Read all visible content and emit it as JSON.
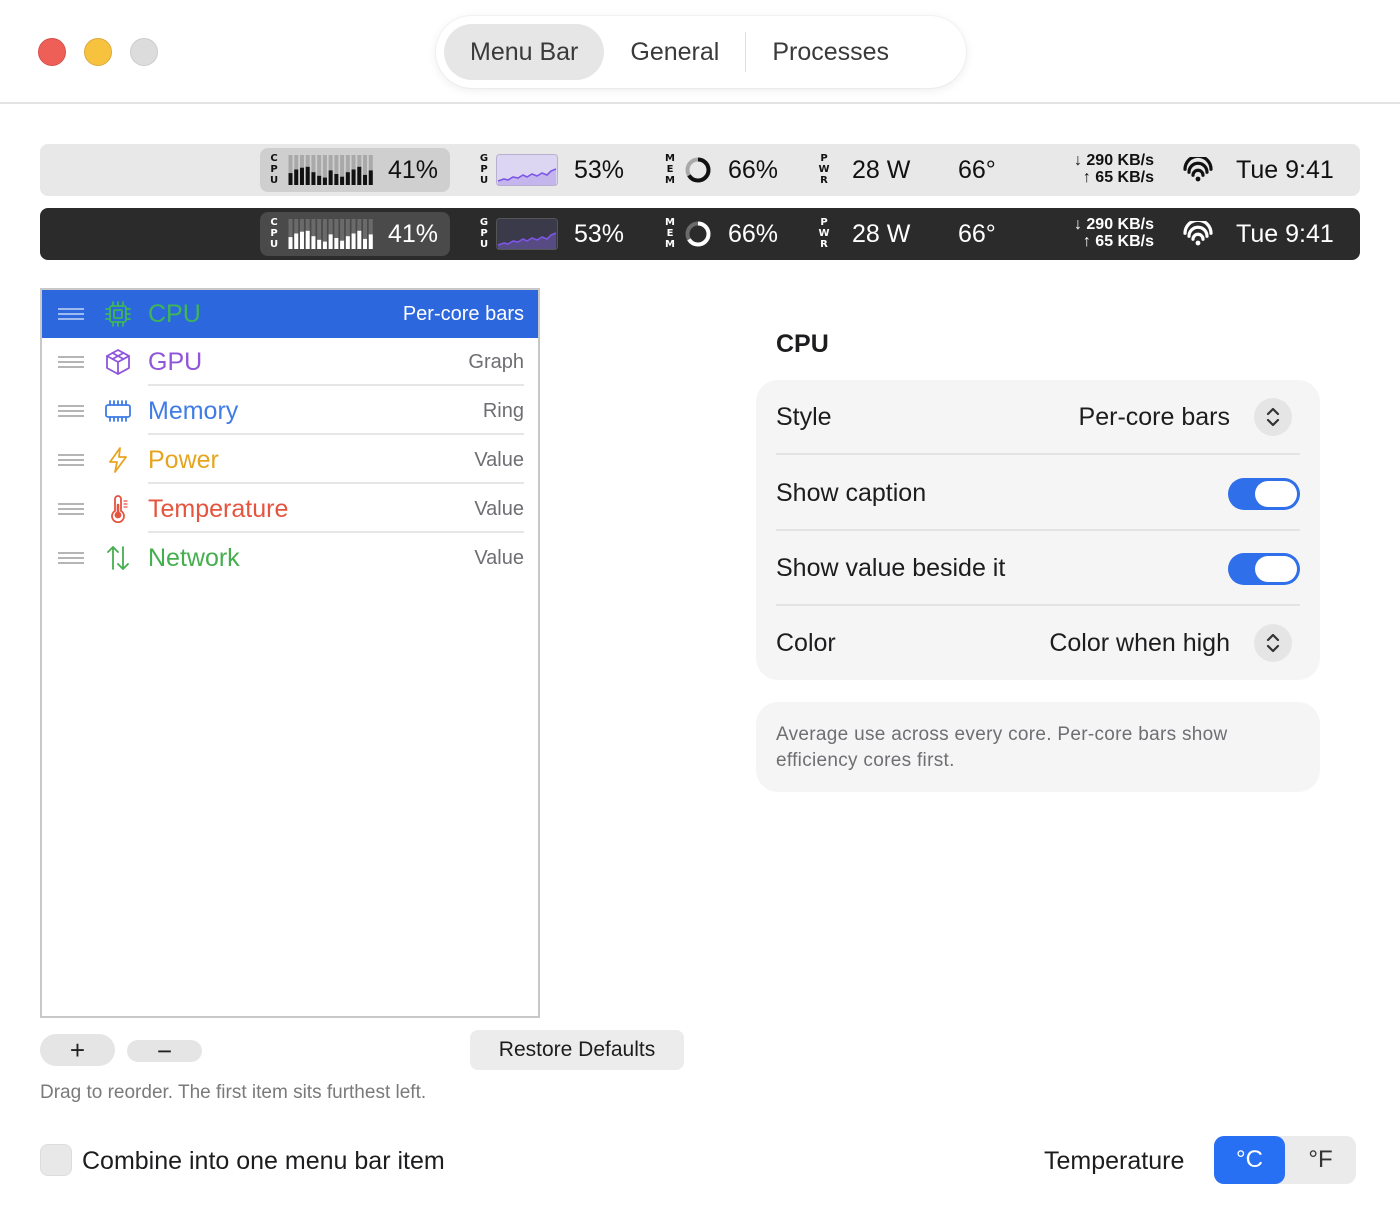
{
  "window": {
    "tabs": [
      {
        "label": "Menu Bar",
        "active": true
      },
      {
        "label": "General",
        "active": false
      },
      {
        "label": "Processes",
        "active": false
      }
    ]
  },
  "menubar_preview": {
    "cpu": {
      "caption": "CPU",
      "value": "41%",
      "core_levels": [
        0.55,
        0.75,
        0.85,
        0.9,
        0.6,
        0.4,
        0.3,
        0.7,
        0.5,
        0.35,
        0.6,
        0.75,
        0.9,
        0.45,
        0.7
      ]
    },
    "gpu": {
      "caption": "GPU",
      "value": "53%"
    },
    "mem": {
      "caption": "MEM",
      "value": "66%",
      "level": 0.66
    },
    "pwr": {
      "caption": "PWR",
      "value": "28 W"
    },
    "temp": {
      "value": "66°"
    },
    "net": {
      "down": "↓ 290 KB/s",
      "up": "↑ 65 KB/s"
    },
    "clock": "Tue 9:41"
  },
  "items": [
    {
      "name": "CPU",
      "style": "Per-core bars",
      "icon": "chip-icon",
      "color": "#3eb559",
      "selected": true
    },
    {
      "name": "GPU",
      "style": "Graph",
      "icon": "cube-icon",
      "color": "#8f55db",
      "selected": false
    },
    {
      "name": "Memory",
      "style": "Ring",
      "icon": "memory-icon",
      "color": "#3f7ce6",
      "selected": false
    },
    {
      "name": "Power",
      "style": "Value",
      "icon": "bolt-icon",
      "color": "#e6a520",
      "selected": false
    },
    {
      "name": "Temperature",
      "style": "Value",
      "icon": "thermometer-icon",
      "color": "#e5543f",
      "selected": false
    },
    {
      "name": "Network",
      "style": "Value",
      "icon": "arrows-updown-icon",
      "color": "#45ae4e",
      "selected": false
    }
  ],
  "list_controls": {
    "add_label": "+",
    "remove_label": "−",
    "restore_label": "Restore Defaults",
    "hint": "Drag to reorder. The first item sits furthest left."
  },
  "settings": {
    "title": "CPU",
    "style_label": "Style",
    "style_value": "Per-core bars",
    "caption_label": "Show caption",
    "caption_on": true,
    "value_label": "Show value beside it",
    "value_on": true,
    "color_label": "Color",
    "color_value": "Color when high",
    "note": "Average use across every core. Per-core bars show efficiency cores first."
  },
  "footer": {
    "combine_label": "Combine into one menu bar item",
    "combine_checked": false,
    "temp_label": "Temperature",
    "units": [
      {
        "label": "°C",
        "active": true
      },
      {
        "label": "°F",
        "active": false
      }
    ]
  },
  "colors": {
    "accent": "#2870f3",
    "selection": "#2c67de"
  }
}
